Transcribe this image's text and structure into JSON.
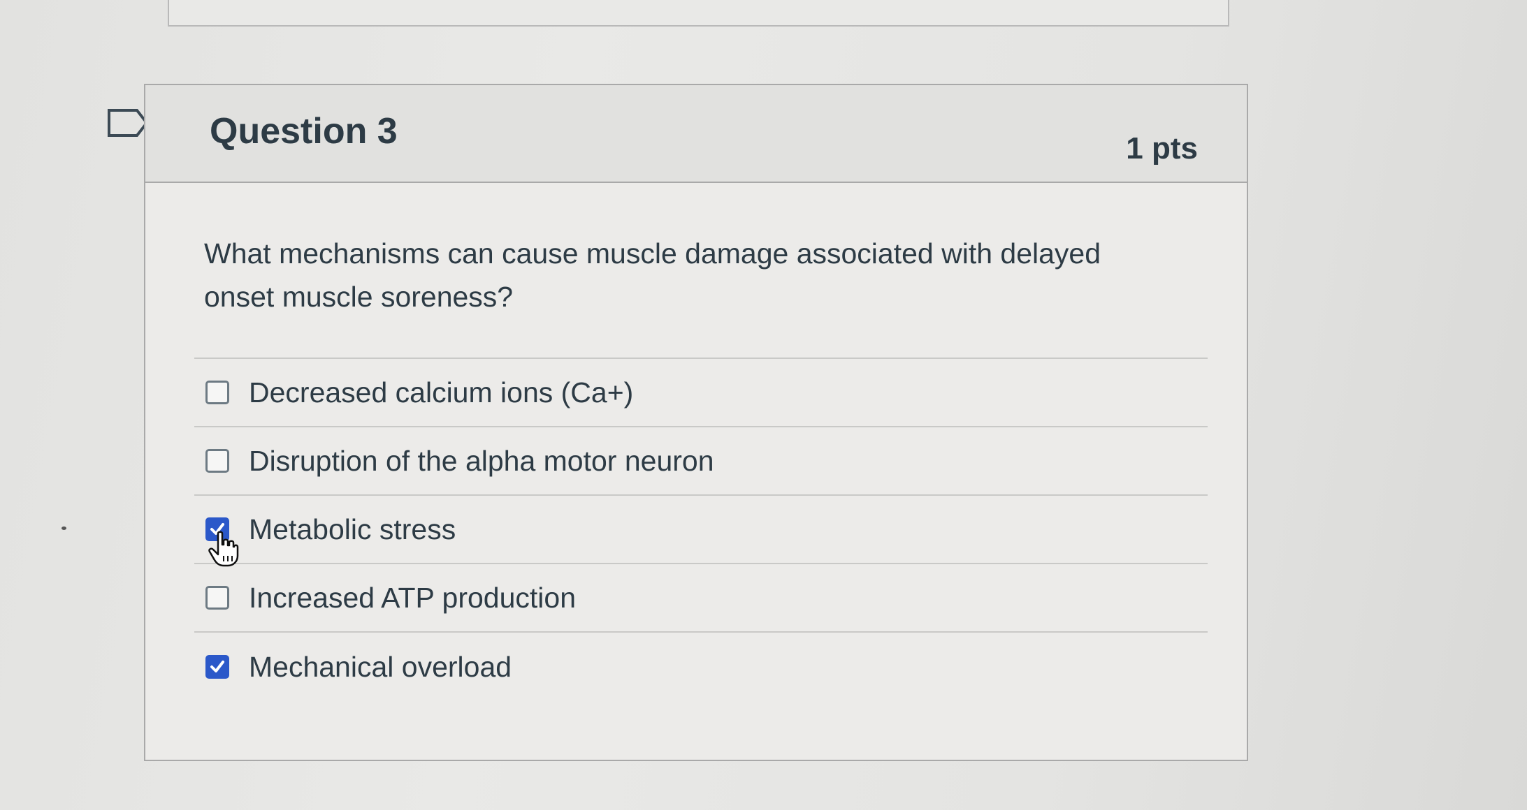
{
  "question": {
    "title": "Question 3",
    "points": "1 pts",
    "text": "What mechanisms can cause muscle damage associated with delayed onset muscle soreness?"
  },
  "answers": [
    {
      "label": "Decreased calcium ions (Ca+)",
      "checked": false
    },
    {
      "label": "Disruption of the alpha motor neuron",
      "checked": false
    },
    {
      "label": "Metabolic stress",
      "checked": true
    },
    {
      "label": "Increased ATP production",
      "checked": false
    },
    {
      "label": "Mechanical overload",
      "checked": true
    }
  ],
  "icons": {
    "flag": "flag-outline-icon",
    "checkbox": "checkbox-icon",
    "check": "checkmark-icon",
    "cursor": "hand-pointer-cursor-icon"
  },
  "colors": {
    "text": "#2d3b45",
    "checked": "#2b58c9",
    "border": "#a9a9a9"
  }
}
